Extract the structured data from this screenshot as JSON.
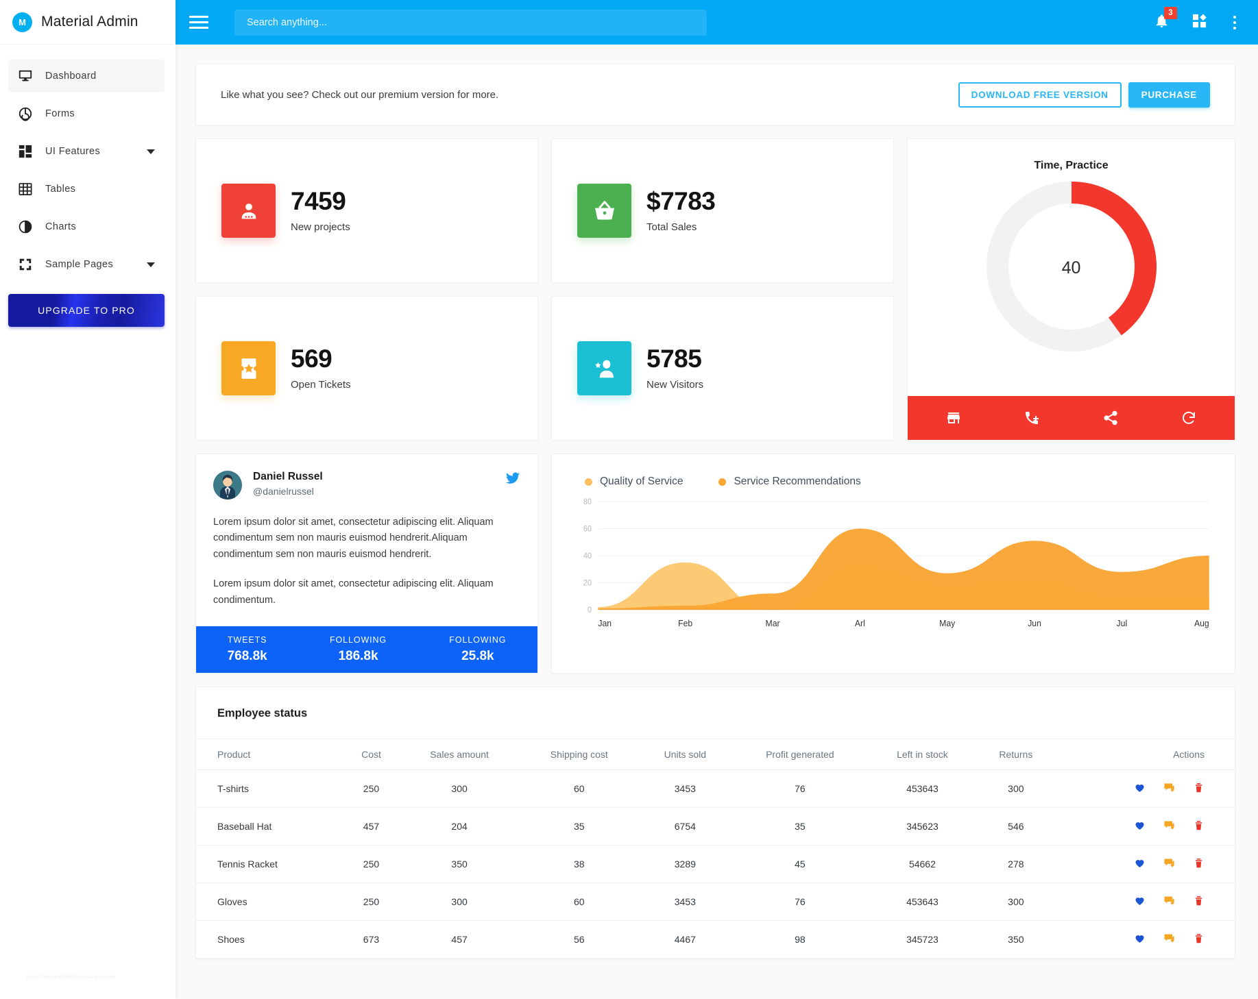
{
  "brand": {
    "logo_letter": "M",
    "title": "Material Admin"
  },
  "sidebar": {
    "items": [
      {
        "label": "Dashboard",
        "icon": "monitor-icon",
        "has_caret": false,
        "active": true
      },
      {
        "label": "Forms",
        "icon": "forms-icon",
        "has_caret": false,
        "active": false
      },
      {
        "label": "UI Features",
        "icon": "ui-features-icon",
        "has_caret": true,
        "active": false
      },
      {
        "label": "Tables",
        "icon": "table-grid-icon",
        "has_caret": false,
        "active": false
      },
      {
        "label": "Charts",
        "icon": "pie-chart-icon",
        "has_caret": false,
        "active": false
      },
      {
        "label": "Sample Pages",
        "icon": "fullscreen-icon",
        "has_caret": true,
        "active": false
      }
    ],
    "upgrade_label": "UPGRADE TO PRO",
    "watermark": "www.freetemplatesforexample.com"
  },
  "topbar": {
    "search_placeholder": "Search anything...",
    "search_value": "",
    "notification_badge": "3",
    "accent_color": "#03a9f4"
  },
  "promo": {
    "text": "Like what you see? Check out our premium version for more.",
    "download_label": "DOWNLOAD FREE VERSION",
    "purchase_label": "PURCHASE"
  },
  "stats": [
    {
      "value": "7459",
      "label": "New projects",
      "color": "#ef4136",
      "icon": "person-card-icon"
    },
    {
      "value": "$7783",
      "label": "Total Sales",
      "color": "#4caf50",
      "icon": "basket-icon"
    },
    {
      "value": "569",
      "label": "Open Tickets",
      "color": "#f9a825",
      "icon": "ticket-star-icon"
    },
    {
      "value": "5785",
      "label": "New Visitors",
      "color": "#1bbfd4",
      "icon": "person-star-icon"
    }
  ],
  "donut": {
    "title": "Time, Practice",
    "center_value": "40",
    "percent": 40,
    "arc_color": "#f4372c",
    "track_color": "#f2f2f2",
    "footer_icons": [
      "store-icon",
      "add-call-icon",
      "share-icon",
      "refresh-icon"
    ]
  },
  "tweet": {
    "name": "Daniel Russel",
    "handle": "@danielrussel",
    "brand_icon": "twitter-bird-icon",
    "paragraph_1": "Lorem ipsum dolor sit amet, consectetur adipiscing elit. Aliquam condimentum sem non mauris euismod hendrerit.Aliquam condimentum sem non mauris euismod hendrerit.",
    "paragraph_2": "Lorem ipsum dolor sit amet, consectetur adipiscing elit. Aliquam condimentum.",
    "stats": [
      {
        "key": "TWEETS",
        "value": "768.8k"
      },
      {
        "key": "FOLLOWING",
        "value": "186.8k"
      },
      {
        "key": "FOLLOWING",
        "value": "25.8k"
      }
    ]
  },
  "chart_data": {
    "type": "area",
    "title": "",
    "xlabel": "",
    "ylabel": "",
    "categories": [
      "Jan",
      "Feb",
      "Mar",
      "Arl",
      "May",
      "Jun",
      "Jul",
      "Aug"
    ],
    "x_tick_labels": [
      "Jan",
      "Feb",
      "Mar",
      "Arl",
      "May",
      "Jun",
      "Jul",
      "Aug"
    ],
    "y_tick_labels": [
      "0",
      "20",
      "40",
      "60",
      "80"
    ],
    "ylim": [
      0,
      80
    ],
    "grid": true,
    "legend_position": "top-left",
    "series": [
      {
        "name": "Quality of Service",
        "color": "#fbbf5c",
        "values": [
          2,
          35,
          0,
          34,
          20,
          22,
          10,
          10
        ]
      },
      {
        "name": "Service Recommendations",
        "color": "#f9a634",
        "values": [
          1,
          3,
          12,
          60,
          27,
          51,
          28,
          40
        ]
      }
    ]
  },
  "table": {
    "title": "Employee status",
    "columns": [
      "Product",
      "Cost",
      "Sales amount",
      "Shipping cost",
      "Units sold",
      "Profit generated",
      "Left in stock",
      "Returns",
      "Actions"
    ],
    "action_icons": [
      "heart-icon",
      "comment-icon",
      "trash-icon"
    ],
    "action_colors": {
      "heart": "#1c54d6",
      "comment": "#f5a623",
      "trash": "#e8352a"
    },
    "rows": [
      {
        "product": "T-shirts",
        "cost": "250",
        "sales": "300",
        "shipping": "60",
        "units": "3453",
        "profit": "76",
        "stock": "453643",
        "returns": "300"
      },
      {
        "product": "Baseball Hat",
        "cost": "457",
        "sales": "204",
        "shipping": "35",
        "units": "6754",
        "profit": "35",
        "stock": "345623",
        "returns": "546"
      },
      {
        "product": "Tennis Racket",
        "cost": "250",
        "sales": "350",
        "shipping": "38",
        "units": "3289",
        "profit": "45",
        "stock": "54662",
        "returns": "278"
      },
      {
        "product": "Gloves",
        "cost": "250",
        "sales": "300",
        "shipping": "60",
        "units": "3453",
        "profit": "76",
        "stock": "453643",
        "returns": "300"
      },
      {
        "product": "Shoes",
        "cost": "673",
        "sales": "457",
        "shipping": "56",
        "units": "4467",
        "profit": "98",
        "stock": "345723",
        "returns": "350"
      }
    ]
  }
}
